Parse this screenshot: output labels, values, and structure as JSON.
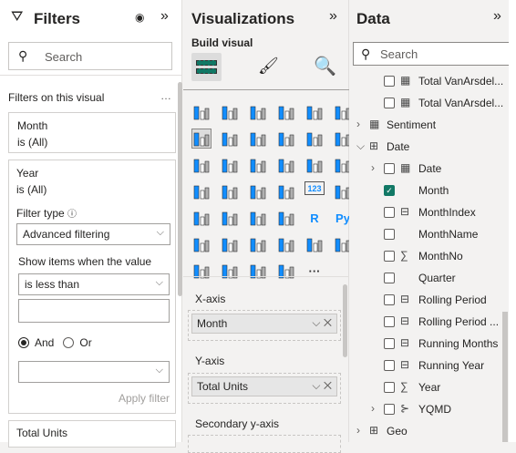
{
  "filters": {
    "title": "Filters",
    "search_placeholder": "Search",
    "section": "Filters on this visual",
    "more": "…",
    "cards": [
      {
        "field": "Month",
        "state": "is (All)"
      },
      {
        "field": "Year",
        "state": "is (All)"
      },
      {
        "field": "Total Units"
      }
    ],
    "filter_type_label": "Filter type",
    "filter_type_value": "Advanced filtering",
    "show_items_label": "Show items when the value",
    "condition_value": "is less than",
    "condition_input": "",
    "and_label": "And",
    "or_label": "Or",
    "logic_selected": "And",
    "second_condition": "",
    "apply": "Apply filter"
  },
  "viz": {
    "title": "Visualizations",
    "build_visual": "Build visual",
    "icons": [
      "stacked-bar",
      "stacked-column",
      "clustered-bar",
      "clustered-column",
      "100-stacked-bar",
      "100-stacked-column",
      "line-chart",
      "area-chart",
      "stacked-area",
      "line-stacked-column",
      "line-clustered-column",
      "ribbon-chart",
      "waterfall",
      "funnel",
      "scatter",
      "pie",
      "donut",
      "treemap",
      "map",
      "filled-map",
      "azure-map",
      "gauge",
      "card",
      "multi-row-card",
      "kpi",
      "slicer",
      "table",
      "matrix",
      "r-visual",
      "python-visual",
      "key-influencers",
      "decomposition-tree",
      "qa",
      "smart-narrative",
      "goals",
      "paginated-report",
      "power-apps",
      "power-automate",
      "power-apps-alt",
      "arrow-visual",
      "more"
    ],
    "glyphs": {
      "r-visual": "R",
      "python-visual": "Py",
      "card": "123",
      "more": "···"
    },
    "wells": [
      {
        "label": "X-axis",
        "field": "Month"
      },
      {
        "label": "Y-axis",
        "field": "Total Units"
      },
      {
        "label": "Secondary y-axis"
      }
    ],
    "accent": "#118dff"
  },
  "data": {
    "title": "Data",
    "search_placeholder": "Search",
    "items": [
      {
        "label": "Total VanArsdel...",
        "level": 2,
        "icon": "calculator",
        "checked": false
      },
      {
        "label": "Total VanArsdel...",
        "level": 2,
        "icon": "calculator",
        "checked": false
      },
      {
        "label": "Sentiment",
        "level": 0,
        "icon": "calculator-table",
        "expand": "collapsed"
      },
      {
        "label": "Date",
        "level": 0,
        "icon": "table-check",
        "expand": "expanded"
      },
      {
        "label": "Date",
        "level": 1,
        "icon": "calendar",
        "checked": false,
        "expand": "collapsed"
      },
      {
        "label": "Month",
        "level": 2,
        "icon": "",
        "checked": true
      },
      {
        "label": "MonthIndex",
        "level": 2,
        "icon": "calc-column-sigma",
        "checked": false
      },
      {
        "label": "MonthName",
        "level": 2,
        "icon": "",
        "checked": false
      },
      {
        "label": "MonthNo",
        "level": 2,
        "icon": "sigma",
        "checked": false
      },
      {
        "label": "Quarter",
        "level": 2,
        "icon": "",
        "checked": false
      },
      {
        "label": "Rolling Period",
        "level": 2,
        "icon": "calc-column-fx",
        "checked": false
      },
      {
        "label": "Rolling Period ...",
        "level": 2,
        "icon": "calc-column-sigma",
        "checked": false
      },
      {
        "label": "Running Months",
        "level": 2,
        "icon": "calc-column-fx",
        "checked": false
      },
      {
        "label": "Running Year",
        "level": 2,
        "icon": "calc-column-sigma",
        "checked": false
      },
      {
        "label": "Year",
        "level": 2,
        "icon": "sigma",
        "checked": false
      },
      {
        "label": "YQMD",
        "level": 1,
        "icon": "hierarchy",
        "checked": false,
        "expand": "collapsed"
      },
      {
        "label": "Geo",
        "level": 0,
        "icon": "table",
        "expand": "collapsed"
      }
    ],
    "check_color": "#117865"
  }
}
